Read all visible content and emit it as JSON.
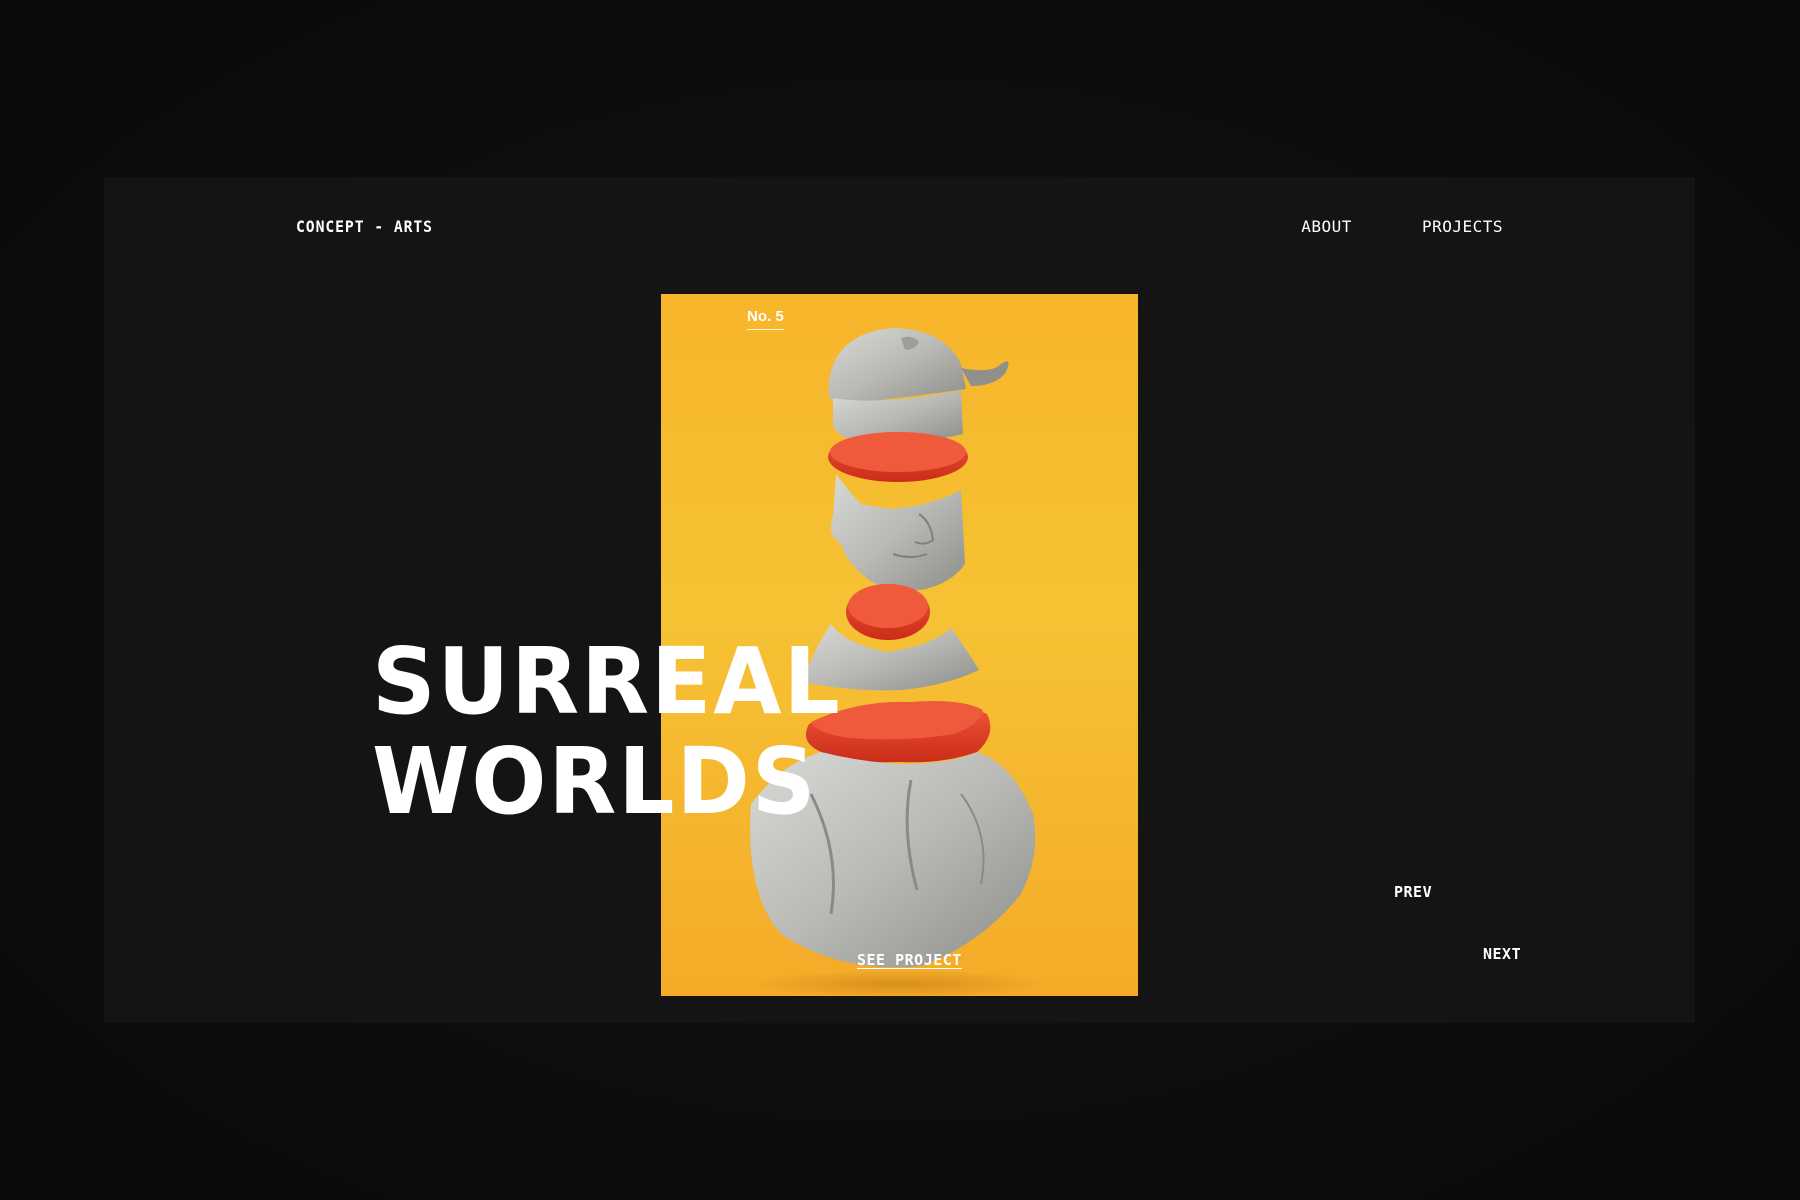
{
  "header": {
    "brand": "CONCEPT - ARTS",
    "nav": {
      "about": "ABOUT",
      "projects": "PROJECTS"
    }
  },
  "hero": {
    "title_line1": "SURREAL",
    "title_line2": "WORLDS"
  },
  "poster": {
    "number_label": "No. 5",
    "cta": "SEE PROJECT",
    "background": "#f6c234",
    "accent": "#e8452a"
  },
  "pager": {
    "prev": "PREV",
    "next": "NEXT"
  }
}
